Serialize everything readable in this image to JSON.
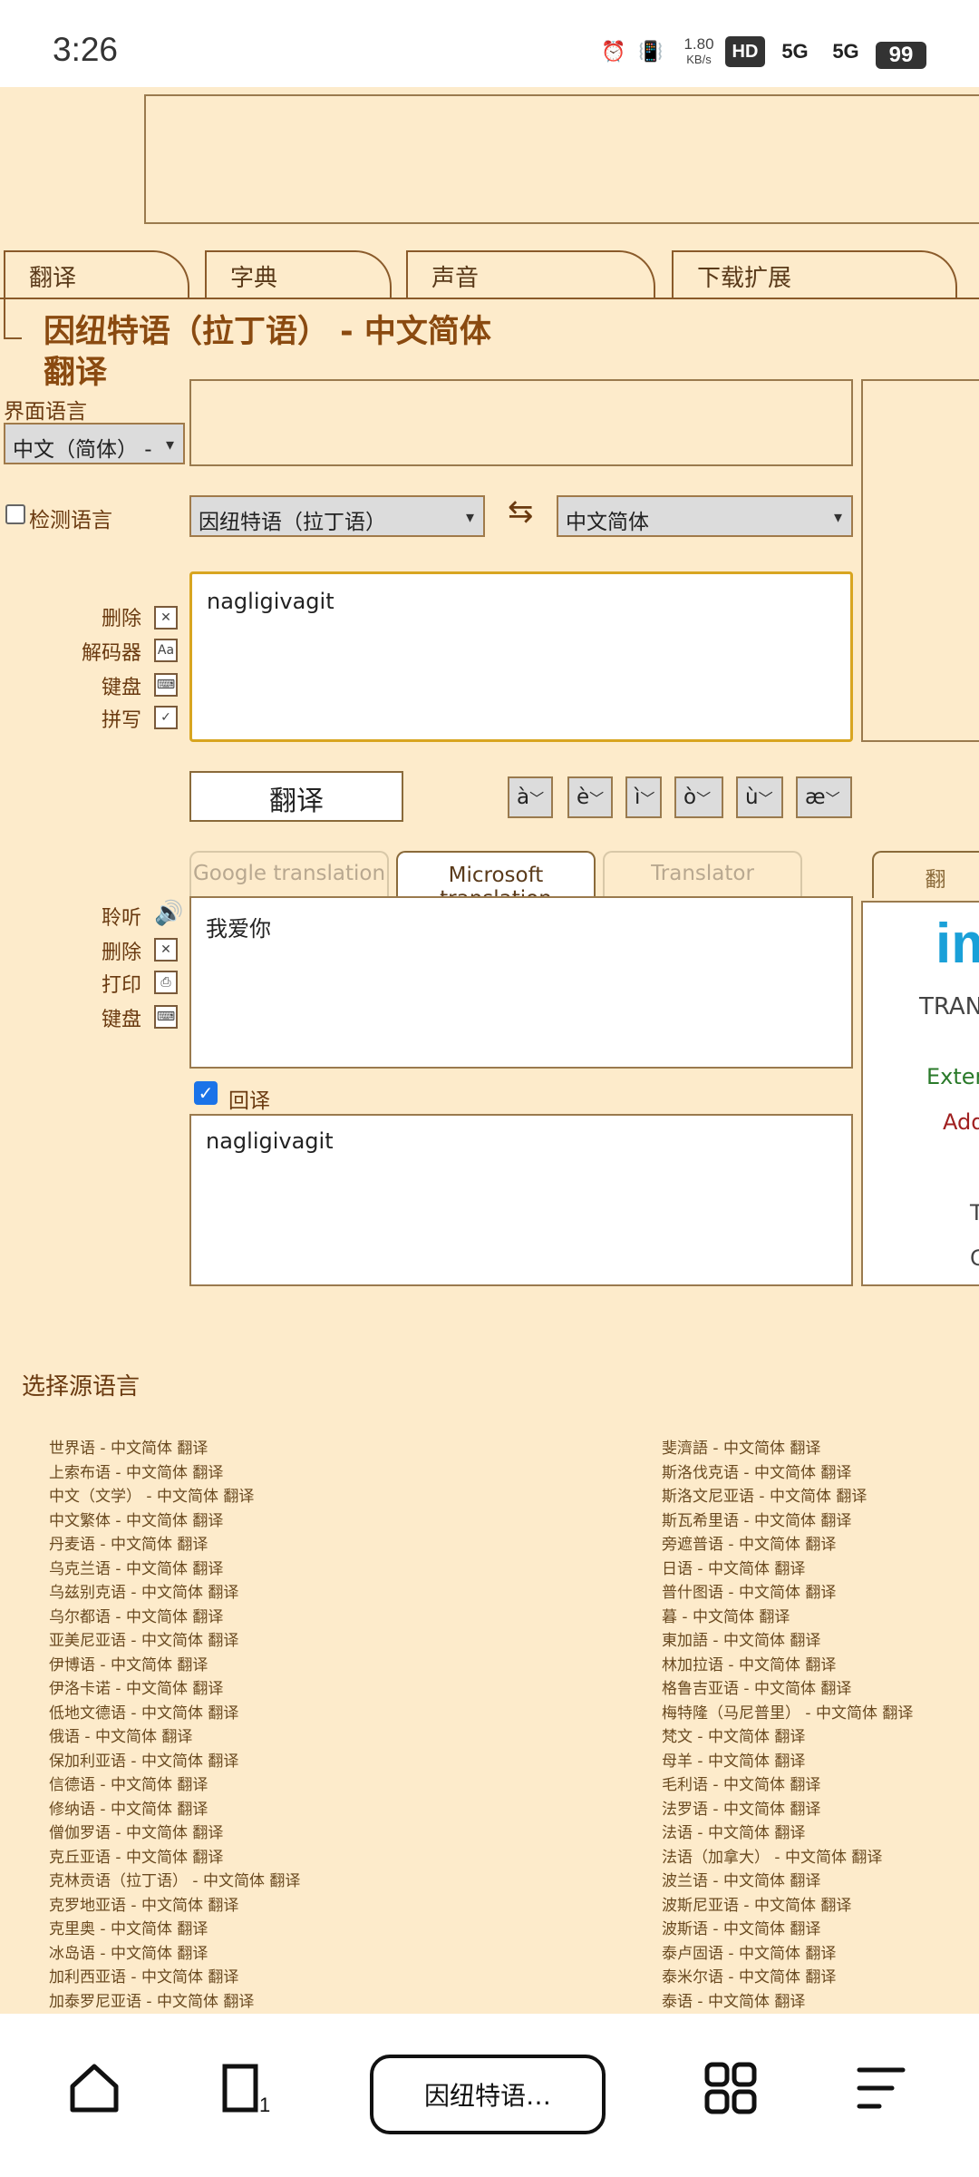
{
  "status_bar": {
    "time": "3:26",
    "net_speed": "1.80",
    "net_unit": "KB/s",
    "hd_label": "HD",
    "signal1": "5G",
    "signal2": "5G",
    "battery": "99"
  },
  "tabs": [
    "翻译",
    "字典",
    "声音",
    "下载扩展"
  ],
  "page_title": "因纽特语（拉丁语） - 中文简体 翻译",
  "ui_language": {
    "label": "界面语言",
    "selected": "中文（简体） -"
  },
  "detect_language": {
    "label": "检测语言",
    "checked": false
  },
  "source_lang": "因纽特语（拉丁语）",
  "target_lang": "中文简体",
  "source_text": "nagligivagit",
  "source_tools": [
    "删除",
    "解码器",
    "键盘",
    "拼写"
  ],
  "translate_button": "翻译",
  "accents": [
    "à",
    "è",
    "ì",
    "ò",
    "ù",
    "æ"
  ],
  "result_tabs": [
    "Google translation",
    "Microsoft translation",
    "Translator",
    "翻"
  ],
  "result_tools": [
    "聆听",
    "删除",
    "打印",
    "键盘"
  ],
  "result_text": "我爱你",
  "back_translation": {
    "label": "回译",
    "checked": true,
    "text": "nagligivagit"
  },
  "right_panel": {
    "logo": "im",
    "line1": "TRAN",
    "line2": "Exten",
    "line3": "Add",
    "line4": "T",
    "line5": "C"
  },
  "choose_source_heading": "选择源语言",
  "lang_links_left": [
    "世界语 - 中文简体 翻译",
    "上索布语 - 中文简体 翻译",
    "中文（文学） - 中文简体 翻译",
    "中文繁体 - 中文简体 翻译",
    "丹麦语 - 中文简体 翻译",
    "乌克兰语 - 中文简体 翻译",
    "乌兹别克语 - 中文简体 翻译",
    "乌尔都语 - 中文简体 翻译",
    "亚美尼亚语 - 中文简体 翻译",
    "伊博语 - 中文简体 翻译",
    "伊洛卡诺 - 中文简体 翻译",
    "低地文德语 - 中文简体 翻译",
    "俄语 - 中文简体 翻译",
    "保加利亚语 - 中文简体 翻译",
    "信德语 - 中文简体 翻译",
    "修纳语 - 中文简体 翻译",
    "僧伽罗语 - 中文简体 翻译",
    "克丘亚语 - 中文简体 翻译",
    "克林贡语（拉丁语） - 中文简体 翻译",
    "克罗地亚语 - 中文简体 翻译",
    "克里奥 - 中文简体 翻译",
    "冰岛语 - 中文简体 翻译",
    "加利西亚语 - 中文简体 翻译",
    "加泰罗尼亚语 - 中文简体 翻译"
  ],
  "lang_links_right": [
    "斐濟語 - 中文简体 翻译",
    "斯洛伐克语 - 中文简体 翻译",
    "斯洛文尼亚语 - 中文简体 翻译",
    "斯瓦希里语 - 中文简体 翻译",
    "旁遮普语 - 中文简体 翻译",
    "日语 - 中文简体 翻译",
    "普什图语 - 中文简体 翻译",
    "暮 - 中文简体 翻译",
    "東加語 - 中文简体 翻译",
    "林加拉语 - 中文简体 翻译",
    "格鲁吉亚语 - 中文简体 翻译",
    "梅特隆（马尼普里） - 中文简体 翻译",
    "梵文 - 中文简体 翻译",
    "母羊 - 中文简体 翻译",
    "毛利语 - 中文简体 翻译",
    "法罗语 - 中文简体 翻译",
    "法语 - 中文简体 翻译",
    "法语（加拿大） - 中文简体 翻译",
    "波兰语 - 中文简体 翻译",
    "波斯尼亚语 - 中文简体 翻译",
    "波斯语 - 中文简体 翻译",
    "泰卢固语 - 中文简体 翻译",
    "泰米尔语 - 中文简体 翻译",
    "泰语 - 中文简体 翻译"
  ],
  "bottom_nav": {
    "tab_title": "因纽特语…",
    "tab_count": "1"
  }
}
